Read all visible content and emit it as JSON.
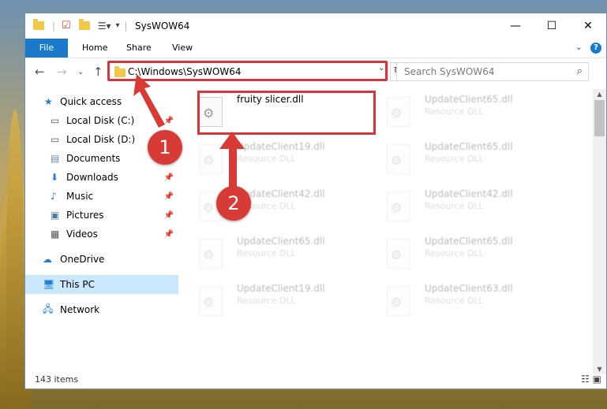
{
  "window": {
    "title": "SysWOW64",
    "controls": {
      "minimize": "—",
      "maximize": "☐",
      "close": "✕"
    }
  },
  "ribbon": {
    "tabs": [
      "File",
      "Home",
      "Share",
      "View"
    ],
    "help": "?"
  },
  "nav": {
    "address": "C:\\Windows\\SysWOW64",
    "search_placeholder": "Search SysWOW64"
  },
  "sidebar": {
    "items": [
      {
        "label": "Quick access",
        "icon": "star-icon"
      },
      {
        "label": "Local Disk (C:)",
        "icon": "drive-icon"
      },
      {
        "label": "Local Disk (D:)",
        "icon": "drive-icon"
      },
      {
        "label": "Documents",
        "icon": "documents-icon"
      },
      {
        "label": "Downloads",
        "icon": "downloads-icon"
      },
      {
        "label": "Music",
        "icon": "music-icon"
      },
      {
        "label": "Pictures",
        "icon": "pictures-icon"
      },
      {
        "label": "Videos",
        "icon": "videos-icon"
      },
      {
        "label": "OneDrive",
        "icon": "cloud-icon"
      },
      {
        "label": "This PC",
        "icon": "computer-icon"
      },
      {
        "label": "Network",
        "icon": "network-icon"
      }
    ]
  },
  "files": [
    {
      "name": "fruity slicer.dll",
      "type": ""
    },
    {
      "name": "UpdateClient65.dll",
      "type": "Resource DLL"
    },
    {
      "name": "UpdateClient19.dll",
      "type": "Resource DLL"
    },
    {
      "name": "UpdateClient65.dll",
      "type": "Resource DLL"
    },
    {
      "name": "UpdateClient42.dll",
      "type": "Resource DLL"
    },
    {
      "name": "UpdateClient42.dll",
      "type": "Resource DLL"
    },
    {
      "name": "UpdateClient65.dll",
      "type": "Resource DLL"
    },
    {
      "name": "UpdateClient65.dll",
      "type": "Resource DLL"
    },
    {
      "name": "UpdateClient19.dll",
      "type": "Resource DLL"
    },
    {
      "name": "UpdateClient63.dll",
      "type": "Resource DLL"
    }
  ],
  "status": {
    "count": "143 items"
  },
  "annotations": {
    "step1": "1",
    "step2": "2",
    "color": "#d83b35"
  }
}
